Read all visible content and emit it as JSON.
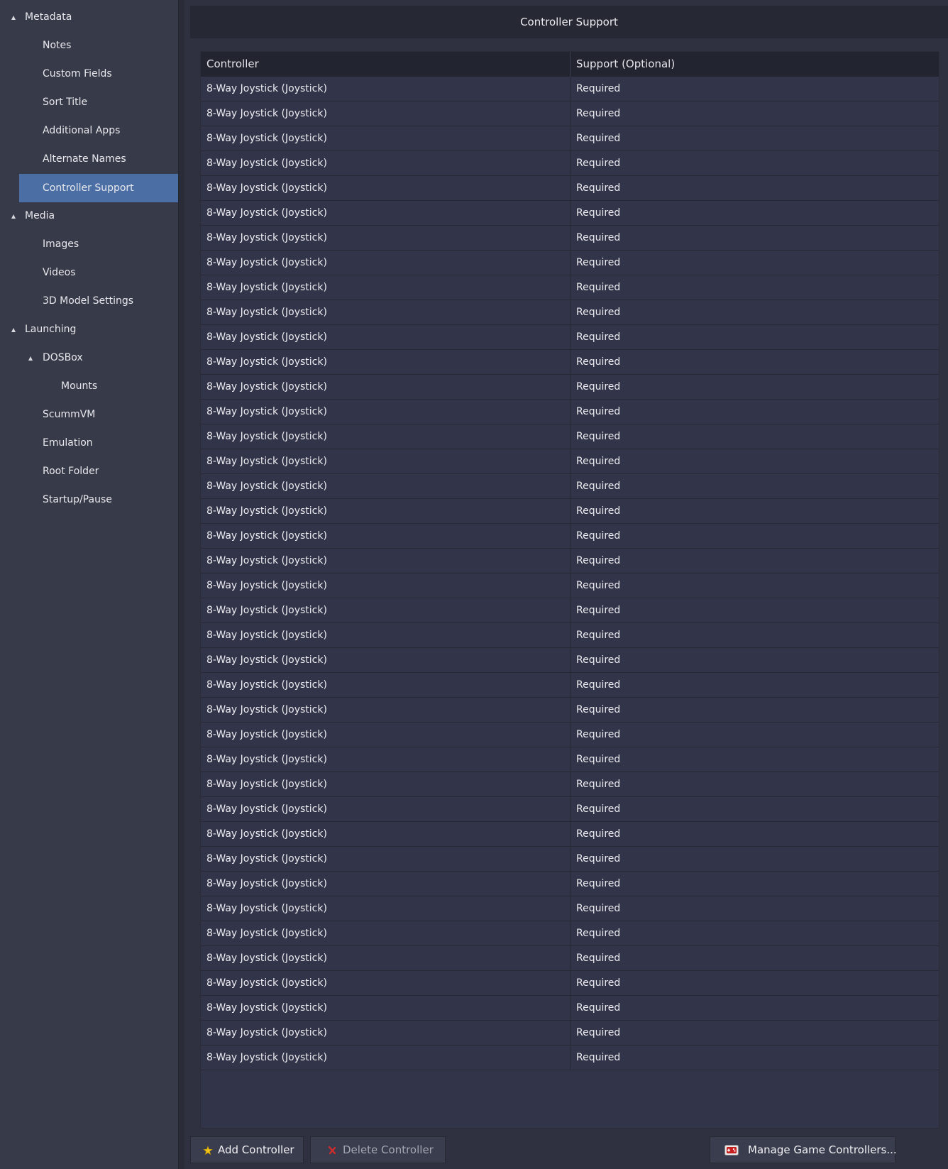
{
  "sidebar": {
    "items": [
      {
        "label": "Metadata",
        "level": 0,
        "expanded": true
      },
      {
        "label": "Notes",
        "level": 1
      },
      {
        "label": "Custom Fields",
        "level": 1
      },
      {
        "label": "Sort Title",
        "level": 1
      },
      {
        "label": "Additional Apps",
        "level": 1
      },
      {
        "label": "Alternate Names",
        "level": 1
      },
      {
        "label": "Controller Support",
        "level": 1,
        "selected": true
      },
      {
        "label": "Media",
        "level": 0,
        "expanded": true
      },
      {
        "label": "Images",
        "level": 1
      },
      {
        "label": "Videos",
        "level": 1
      },
      {
        "label": "3D Model Settings",
        "level": 1
      },
      {
        "label": "Launching",
        "level": 0,
        "expanded": true
      },
      {
        "label": "DOSBox",
        "level": 1,
        "expanded": true
      },
      {
        "label": "Mounts",
        "level": 2
      },
      {
        "label": "ScummVM",
        "level": 1
      },
      {
        "label": "Emulation",
        "level": 1
      },
      {
        "label": "Root Folder",
        "level": 1
      },
      {
        "label": "Startup/Pause",
        "level": 1
      }
    ]
  },
  "header": {
    "title": "Controller Support"
  },
  "table": {
    "columns": [
      "Controller",
      "Support (Optional)"
    ],
    "rows": [
      [
        "8-Way Joystick (Joystick)",
        "Required"
      ],
      [
        "8-Way Joystick (Joystick)",
        "Required"
      ],
      [
        "8-Way Joystick (Joystick)",
        "Required"
      ],
      [
        "8-Way Joystick (Joystick)",
        "Required"
      ],
      [
        "8-Way Joystick (Joystick)",
        "Required"
      ],
      [
        "8-Way Joystick (Joystick)",
        "Required"
      ],
      [
        "8-Way Joystick (Joystick)",
        "Required"
      ],
      [
        "8-Way Joystick (Joystick)",
        "Required"
      ],
      [
        "8-Way Joystick (Joystick)",
        "Required"
      ],
      [
        "8-Way Joystick (Joystick)",
        "Required"
      ],
      [
        "8-Way Joystick (Joystick)",
        "Required"
      ],
      [
        "8-Way Joystick (Joystick)",
        "Required"
      ],
      [
        "8-Way Joystick (Joystick)",
        "Required"
      ],
      [
        "8-Way Joystick (Joystick)",
        "Required"
      ],
      [
        "8-Way Joystick (Joystick)",
        "Required"
      ],
      [
        "8-Way Joystick (Joystick)",
        "Required"
      ],
      [
        "8-Way Joystick (Joystick)",
        "Required"
      ],
      [
        "8-Way Joystick (Joystick)",
        "Required"
      ],
      [
        "8-Way Joystick (Joystick)",
        "Required"
      ],
      [
        "8-Way Joystick (Joystick)",
        "Required"
      ],
      [
        "8-Way Joystick (Joystick)",
        "Required"
      ],
      [
        "8-Way Joystick (Joystick)",
        "Required"
      ],
      [
        "8-Way Joystick (Joystick)",
        "Required"
      ],
      [
        "8-Way Joystick (Joystick)",
        "Required"
      ],
      [
        "8-Way Joystick (Joystick)",
        "Required"
      ],
      [
        "8-Way Joystick (Joystick)",
        "Required"
      ],
      [
        "8-Way Joystick (Joystick)",
        "Required"
      ],
      [
        "8-Way Joystick (Joystick)",
        "Required"
      ],
      [
        "8-Way Joystick (Joystick)",
        "Required"
      ],
      [
        "8-Way Joystick (Joystick)",
        "Required"
      ],
      [
        "8-Way Joystick (Joystick)",
        "Required"
      ],
      [
        "8-Way Joystick (Joystick)",
        "Required"
      ],
      [
        "8-Way Joystick (Joystick)",
        "Required"
      ],
      [
        "8-Way Joystick (Joystick)",
        "Required"
      ],
      [
        "8-Way Joystick (Joystick)",
        "Required"
      ],
      [
        "8-Way Joystick (Joystick)",
        "Required"
      ],
      [
        "8-Way Joystick (Joystick)",
        "Required"
      ],
      [
        "8-Way Joystick (Joystick)",
        "Required"
      ],
      [
        "8-Way Joystick (Joystick)",
        "Required"
      ],
      [
        "8-Way Joystick (Joystick)",
        "Required"
      ]
    ]
  },
  "buttons": {
    "add": {
      "label": "Add Controller",
      "icon": "add-star-icon"
    },
    "delete": {
      "label": "Delete Controller",
      "icon": "delete-x-icon",
      "disabled": true
    },
    "manage": {
      "label": "Manage Game Controllers...",
      "icon": "game-controller-icon"
    }
  },
  "colors": {
    "selected": "#4b6fa5",
    "add_icon": "#f0c419",
    "delete_icon": "#d12b2b"
  }
}
